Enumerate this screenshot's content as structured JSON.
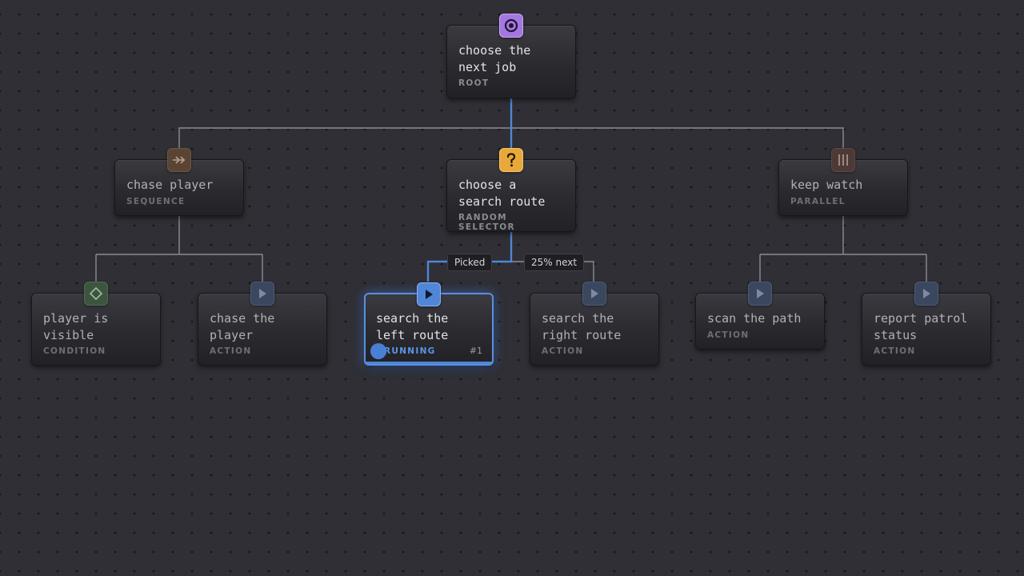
{
  "diagram": {
    "nodes": {
      "root": {
        "title": "choose the\nnext job",
        "type": "ROOT",
        "icon": "target-icon"
      },
      "chase": {
        "title": "chase player",
        "type": "SEQUENCE",
        "icon": "sequence-arrows-icon"
      },
      "search": {
        "title": "choose a\nsearch route",
        "type": "RANDOM SELECTOR",
        "icon": "question-icon"
      },
      "watch": {
        "title": "keep watch",
        "type": "PARALLEL",
        "icon": "parallel-bars-icon"
      },
      "visible": {
        "title": "player is\nvisible",
        "type": "CONDITION",
        "icon": "diamond-icon"
      },
      "chase_action": {
        "title": "chase the\nplayer",
        "type": "ACTION",
        "icon": "play-icon"
      },
      "left_route": {
        "title": "search the\nleft route",
        "type": "RUNNING",
        "run_count": "#1",
        "icon": "play-icon"
      },
      "right_route": {
        "title": "search the\nright route",
        "type": "ACTION",
        "icon": "play-icon"
      },
      "scan": {
        "title": "scan the path",
        "type": "ACTION",
        "icon": "play-icon"
      },
      "report": {
        "title": "report patrol\nstatus",
        "type": "ACTION",
        "icon": "play-icon"
      }
    },
    "edge_labels": {
      "picked": "Picked",
      "next": "25% next"
    },
    "colors": {
      "root_icon": "#a477e0",
      "selector_icon": "#e8a93a",
      "sequence_icon": "#5a4535",
      "parallel_icon": "#4d3935",
      "condition_icon": "#3d5440",
      "action_icon": "#3b475e",
      "active_accent": "#4f86d8",
      "connector": "#8c8c96"
    }
  }
}
